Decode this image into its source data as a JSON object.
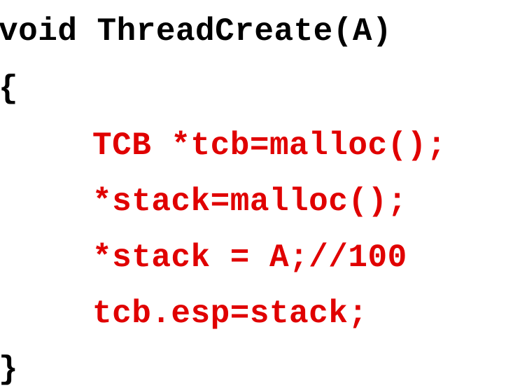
{
  "code": {
    "signature": "void ThreadCreate(A)",
    "open_brace": "{",
    "body": [
      "TCB *tcb=malloc();",
      "*stack=malloc();",
      "*stack = A;//100",
      "tcb.esp=stack;"
    ],
    "close_brace": "}"
  },
  "colors": {
    "text": "#000000",
    "highlight": "#e00000",
    "background": "#ffffff"
  }
}
